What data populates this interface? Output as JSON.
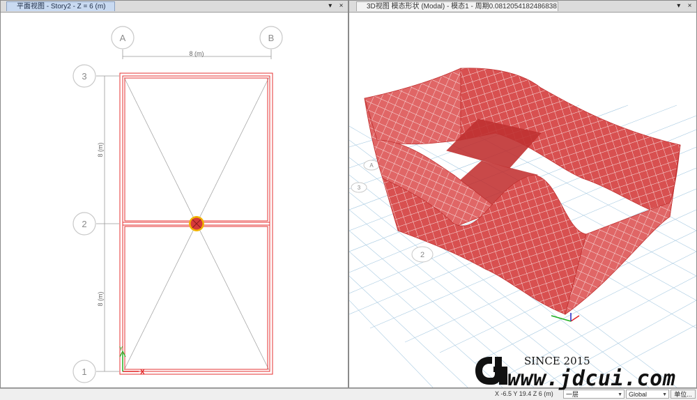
{
  "left_view": {
    "tab_title": "平面视图 - Story2 - Z = 6 (m)",
    "grid_x_labels": [
      "A",
      "B"
    ],
    "grid_y_labels": [
      "3",
      "2",
      "1"
    ],
    "dim_horizontal": "8 (m)",
    "dim_vertical_upper": "8 (m)",
    "dim_vertical_lower": "8 (m)",
    "axis_x_label": "X",
    "axis_y_label": "Y"
  },
  "right_view": {
    "tab_title": "3D视图  模态形状 (Modal) - 模态1 - 周期0.0812054182486838",
    "grid_labels": [
      "A",
      "3",
      "2"
    ]
  },
  "window_controls": {
    "pin": "▾",
    "close": "×"
  },
  "status_bar": {
    "coords": "X -6.5  Y 19.4  Z 6 (m)",
    "story_select": "一层",
    "coord_system_select": "Global",
    "units_button": "单位..."
  },
  "watermark": {
    "since": "SINCE 2015",
    "url": "www.jdcui.com"
  },
  "colors": {
    "frame": "#e53030",
    "shell": "#d94c4c",
    "grid": "#9fc3dc",
    "bubble": "#c8c8c8",
    "axis_x": "#e02020",
    "axis_y": "#20b020"
  }
}
